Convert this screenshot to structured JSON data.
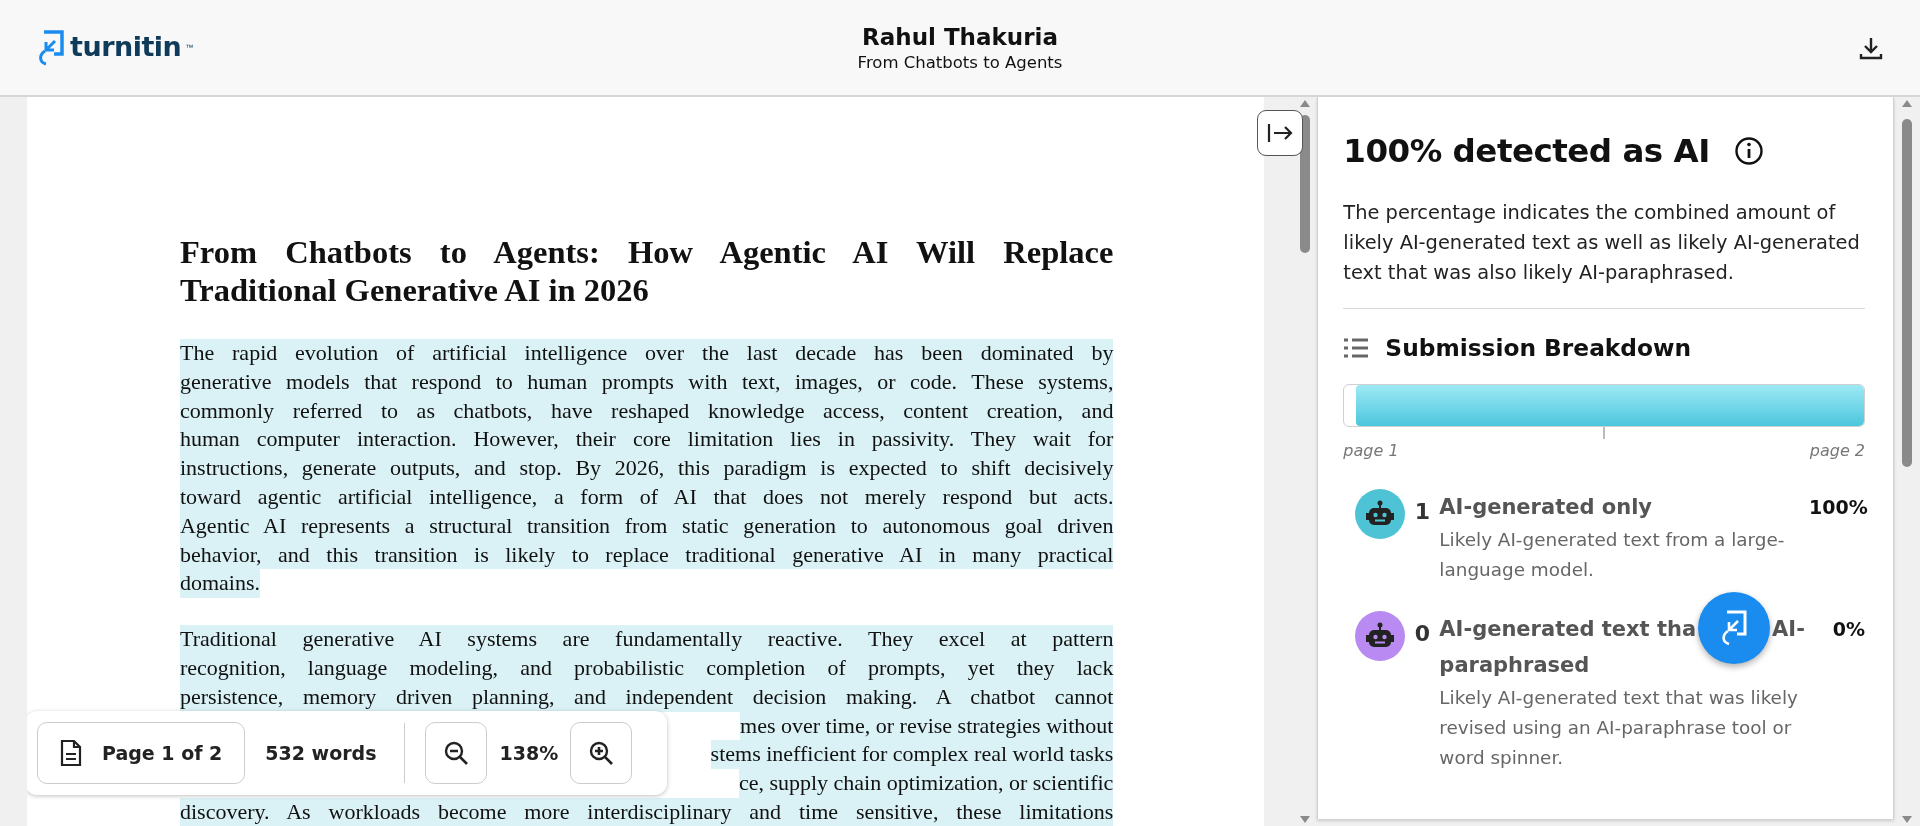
{
  "header": {
    "logo_text": "turnitin",
    "logo_mark": "™",
    "author": "Rahul Thakuria",
    "title": "From Chatbots to Agents"
  },
  "document": {
    "title": "From Chatbots to Agents: How Agentic AI Will Replace Traditional Generative AI in 2026",
    "paragraphs": [
      {
        "kind": "lines",
        "highlighted": true,
        "complete": true,
        "lines": [
          {
            "text": "The rapid evolution of artificial intelligence over the last decade has been dominated by",
            "covered": false
          },
          {
            "text": "generative models that respond to human prompts with text, images, or code. These systems,",
            "covered": false
          },
          {
            "text": "commonly referred to as chatbots, have reshaped knowledge access, content creation, and",
            "covered": false
          },
          {
            "text": "human computer interaction. However, their core limitation lies in passivity. They wait for",
            "covered": false
          },
          {
            "text": "instructions, generate outputs, and stop. By 2026, this paradigm is expected to shift decisively",
            "covered": false
          },
          {
            "text": "toward agentic artificial intelligence, a form of AI that does not merely respond but acts.",
            "covered": false
          },
          {
            "text": "Agentic AI represents a structural transition from static generation to autonomous goal driven",
            "covered": false
          },
          {
            "text": "behavior, and this transition is likely to replace traditional generative AI in many practical",
            "covered": false
          },
          {
            "text": "domains.",
            "covered": false
          }
        ]
      },
      {
        "kind": "lines",
        "highlighted": true,
        "lines": [
          {
            "text": "Traditional generative AI systems are fundamentally reactive. They excel at pattern",
            "covered": false
          },
          {
            "text": "recognition, language modeling, and probabilistic completion of prompts, yet they lack",
            "covered": false
          },
          {
            "text": "persistence, memory driven planning, and independent decision making. A chatbot cannot",
            "covered": false
          },
          {
            "text": "mes over time, or revise strategies without",
            "covered": true
          },
          {
            "text": "stems inefficient for complex real world tasks",
            "covered": true
          },
          {
            "text": "ce, supply chain optimization, or scientific",
            "covered": true
          },
          {
            "text": "discovery. As workloads become more interdisciplinary and time sensitive, these limitations",
            "covered": false
          }
        ]
      }
    ]
  },
  "toolbar": {
    "page": "Page 1 of 2",
    "words": "532 words",
    "zoom": "138%"
  },
  "panel": {
    "heading": "100% detected as AI",
    "description": "The percentage indicates the combined amount of likely AI-generated text as well as likely AI-generated text that was also likely AI-paraphrased.",
    "breakdown_title": "Submission Breakdown",
    "level": 0.978,
    "page_labels": [
      "page 1",
      "page 2"
    ],
    "items": [
      {
        "count": "1",
        "title_lines": [
          [
            "AI-generated only"
          ]
        ],
        "description": "Likely AI-generated text from a large-language model.",
        "percent": "100%",
        "color": "#4fc3d6"
      },
      {
        "count": "0",
        "title_lines": [
          [
            "AI-generated text tha",
            "AI-"
          ],
          [
            "paraphrased"
          ]
        ],
        "description": "Likely AI-generated text that was likely revised using an AI-paraphrase tool or word spinner.",
        "percent": "0%",
        "color": "#b98af2"
      }
    ]
  }
}
